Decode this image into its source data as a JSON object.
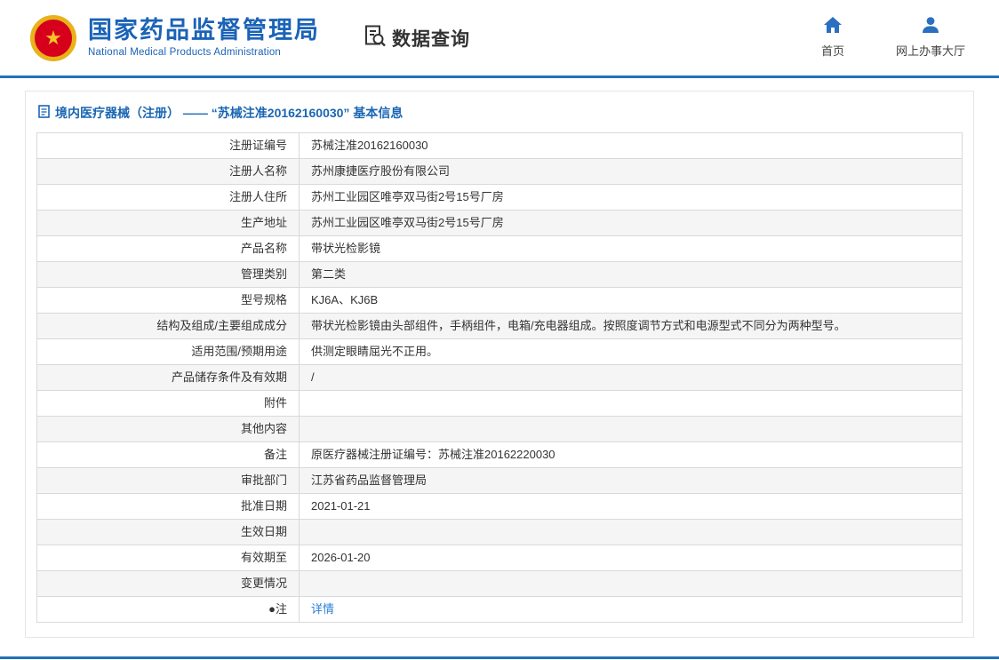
{
  "header": {
    "org_name_cn": "国家药品监督管理局",
    "org_name_en": "National Medical Products Administration",
    "data_query_label": "数据查询",
    "nav_home": "首页",
    "nav_hall": "网上办事大厅"
  },
  "page": {
    "title": "境内医疗器械（注册） —— “苏械注准20162160030” 基本信息"
  },
  "table": {
    "rows": [
      {
        "label": "注册证编号",
        "value": "苏械注准20162160030"
      },
      {
        "label": "注册人名称",
        "value": "苏州康捷医疗股份有限公司"
      },
      {
        "label": "注册人住所",
        "value": "苏州工业园区唯亭双马街2号15号厂房"
      },
      {
        "label": "生产地址",
        "value": "苏州工业园区唯亭双马街2号15号厂房"
      },
      {
        "label": "产品名称",
        "value": "带状光检影镜"
      },
      {
        "label": "管理类别",
        "value": "第二类"
      },
      {
        "label": "型号规格",
        "value": "KJ6A、KJ6B"
      },
      {
        "label": "结构及组成/主要组成成分",
        "value": "带状光检影镜由头部组件，手柄组件，电箱/充电器组成。按照度调节方式和电源型式不同分为两种型号。"
      },
      {
        "label": "适用范围/预期用途",
        "value": "供测定眼睛屈光不正用。"
      },
      {
        "label": "产品储存条件及有效期",
        "value": "/"
      },
      {
        "label": "附件",
        "value": ""
      },
      {
        "label": "其他内容",
        "value": ""
      },
      {
        "label": "备注",
        "value": "原医疗器械注册证编号：苏械注准20162220030"
      },
      {
        "label": "审批部门",
        "value": "江苏省药品监督管理局"
      },
      {
        "label": "批准日期",
        "value": "2021-01-21"
      },
      {
        "label": "生效日期",
        "value": ""
      },
      {
        "label": "有效期至",
        "value": "2026-01-20"
      },
      {
        "label": "变更情况",
        "value": ""
      },
      {
        "label": "●注",
        "value": "详情",
        "is_link": true
      }
    ]
  },
  "icons": {
    "logo": "national-emblem-icon",
    "data_query": "document-search-icon",
    "home": "home-icon",
    "hall": "person-icon",
    "title": "document-icon"
  },
  "colors": {
    "accent_blue": "#2570b7",
    "title_blue": "#1a66b3",
    "link_blue": "#2a7fd4",
    "row_alt_bg": "#f5f5f5",
    "emblem_red": "#d6001c",
    "emblem_gold": "#e8b21a"
  }
}
